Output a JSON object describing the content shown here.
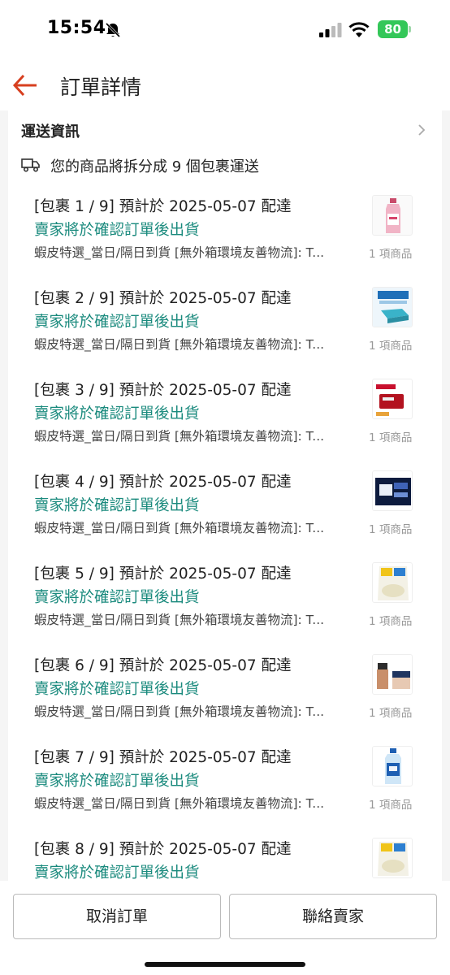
{
  "status_bar": {
    "time": "15:54",
    "battery": "80",
    "icons": [
      "bell-slash-icon",
      "signal-icon",
      "wifi-icon",
      "battery-icon"
    ]
  },
  "header": {
    "title": "訂單詳情",
    "back_icon": "arrow-left-icon",
    "accent_color": "#d73f1f"
  },
  "shipping": {
    "section_title": "運送資訊",
    "split_note": "您的商品將拆分成 9 個包裹運送",
    "packages": [
      {
        "title": "[包裹 1 / 9] 預計於 2025-05-07 配達",
        "status": "賣家將於確認訂單後出貨",
        "carrier": "蝦皮特選_當日/隔日到貨 [無外箱環境友善物流]: T...",
        "count": "1 項商品"
      },
      {
        "title": "[包裹 2 / 9] 預計於 2025-05-07 配達",
        "status": "賣家將於確認訂單後出貨",
        "carrier": "蝦皮特選_當日/隔日到貨 [無外箱環境友善物流]: T...",
        "count": "1 項商品"
      },
      {
        "title": "[包裹 3 / 9] 預計於 2025-05-07 配達",
        "status": "賣家將於確認訂單後出貨",
        "carrier": "蝦皮特選_當日/隔日到貨 [無外箱環境友善物流]: T...",
        "count": "1 項商品"
      },
      {
        "title": "[包裹 4 / 9] 預計於 2025-05-07 配達",
        "status": "賣家將於確認訂單後出貨",
        "carrier": "蝦皮特選_當日/隔日到貨 [無外箱環境友善物流]: T...",
        "count": "1 項商品"
      },
      {
        "title": "[包裹 5 / 9] 預計於 2025-05-07 配達",
        "status": "賣家將於確認訂單後出貨",
        "carrier": "蝦皮特選_當日/隔日到貨 [無外箱環境友善物流]: T...",
        "count": "1 項商品"
      },
      {
        "title": "[包裹 6 / 9] 預計於 2025-05-07 配達",
        "status": "賣家將於確認訂單後出貨",
        "carrier": "蝦皮特選_當日/隔日到貨 [無外箱環境友善物流]: T...",
        "count": "1 項商品"
      },
      {
        "title": "[包裹 7 / 9] 預計於 2025-05-07 配達",
        "status": "賣家將於確認訂單後出貨",
        "carrier": "蝦皮特選_當日/隔日到貨 [無外箱環境友善物流]: T...",
        "count": "1 項商品"
      },
      {
        "title": "[包裹 8 / 9] 預計於 2025-05-07 配達",
        "status": "賣家將於確認訂單後出貨",
        "carrier": "",
        "count": ""
      }
    ]
  },
  "actions": {
    "cancel_label": "取消訂單",
    "contact_label": "聯絡賣家"
  }
}
